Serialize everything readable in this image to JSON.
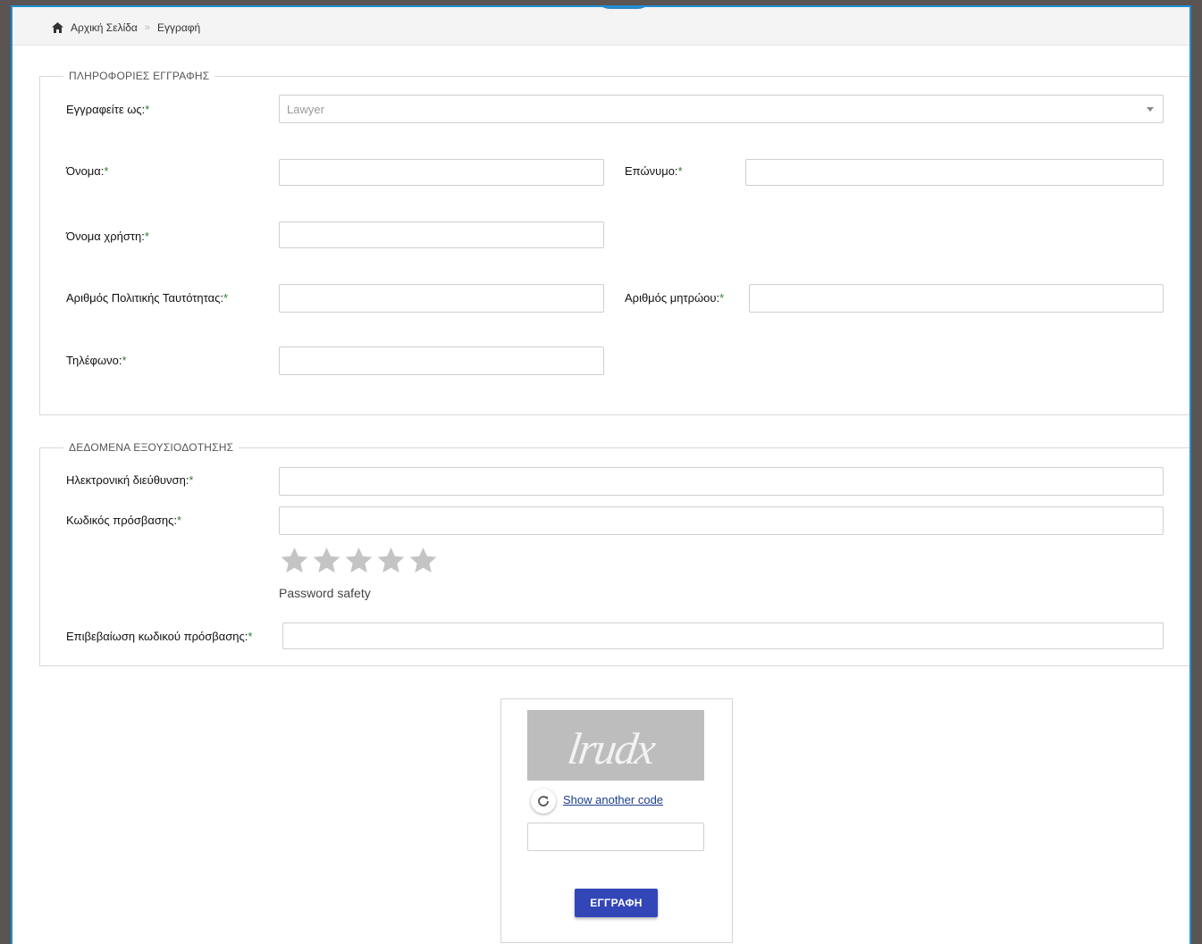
{
  "breadcrumb": {
    "home": "Αρχική Σελίδα",
    "separator": "»",
    "current": "Εγγραφή"
  },
  "section_registration": {
    "legend": "ΠΛΗΡΟΦΟΡΙΕΣ ΕΓΓΡΑΦΗΣ",
    "register_as_label": "Εγγραφείτε ως:",
    "register_as_value": "Lawyer",
    "first_name_label": "Όνομα:",
    "last_name_label": "Επώνυμο:",
    "username_label": "Όνομα χρήστη:",
    "id_number_label": "Αριθμός Πολιτικής Ταυτότητας:",
    "registry_number_label": "Αριθμός μητρώου:",
    "phone_label": "Τηλέφωνο:"
  },
  "section_auth": {
    "legend": "ΔΕΔΟΜΕΝΑ ΕΞΟΥΣΙΟΔΟΤΗΣΗΣ",
    "email_label": "Ηλεκτρονική διεύθυνση:",
    "password_label": "Κωδικός πρόσβασης:",
    "password_safety": "Password safety",
    "password_strength_stars": 0,
    "password_strength_max": 5,
    "confirm_password_label": "Επιβεβαίωση κωδικού πρόσβασης:"
  },
  "required_marker": "*",
  "captcha": {
    "image_text": "lrudx",
    "refresh_label": "Show another code",
    "submit_label": "ΕΓΓΡΑΦΗ"
  },
  "colors": {
    "accent_border": "#1e8fd6",
    "required": "#2e7d32",
    "submit_button": "#3346b8",
    "star_inactive": "#c4c4c4"
  }
}
